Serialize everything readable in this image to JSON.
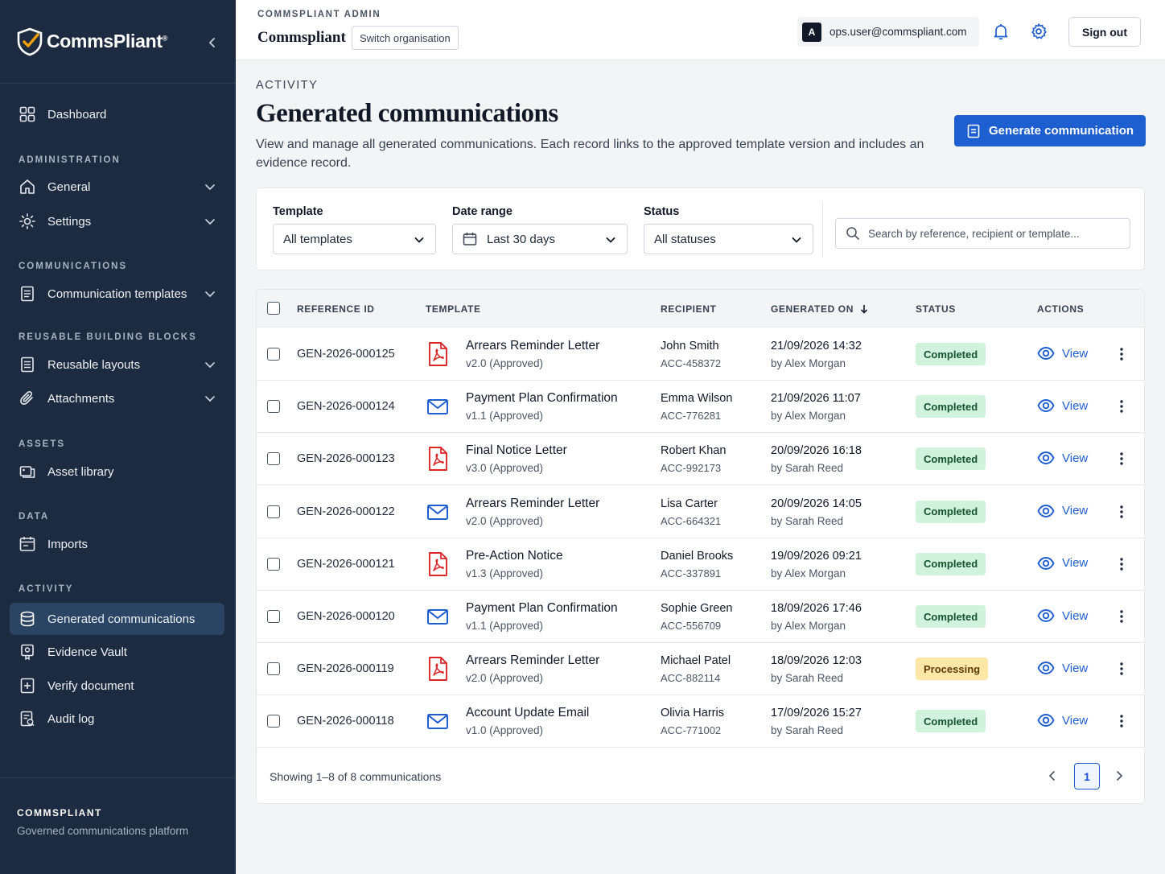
{
  "colors": {
    "sidebar_bg": "#1c2b3f",
    "primary": "#1d5fd1",
    "completed_bg": "#d1f2dc",
    "processing_bg": "#fde7a6",
    "pdf_red": "#dc2626"
  },
  "sidebar": {
    "logo_text": "CommsPliant",
    "logo_reg": "®",
    "dashboard": "Dashboard",
    "sections": {
      "administration": "ADMINISTRATION",
      "communications": "COMMUNICATIONS",
      "reusable": "REUSABLE BUILDING BLOCKS",
      "assets": "ASSETS",
      "data": "DATA",
      "activity": "ACTIVITY"
    },
    "items": {
      "general": "General",
      "settings": "Settings",
      "communication_templates": "Communication templates",
      "reusable_layouts": "Reusable layouts",
      "attachments": "Attachments",
      "asset_library": "Asset library",
      "imports": "Imports",
      "generated_communications": "Generated communications",
      "evidence_vault": "Evidence Vault",
      "verify_document": "Verify document",
      "audit_log": "Audit log"
    },
    "footer_title": "COMMSPLIANT",
    "footer_subtitle": "Governed communications platform"
  },
  "topbar": {
    "kicker": "COMMSPLIANT ADMIN",
    "brand": "Commspliant",
    "switch_org": "Switch organisation",
    "avatar_initial": "A",
    "email": "ops.user@commspliant.com",
    "sign_out": "Sign out"
  },
  "header": {
    "kicker": "ACTIVITY",
    "title": "Generated communications",
    "description": "View and manage all generated communications. Each record links to the approved template version and includes an evidence record.",
    "generate_button": "Generate communication"
  },
  "filters": {
    "template_label": "Template",
    "template_value": "All templates",
    "date_label": "Date range",
    "date_value": "Last 30 days",
    "status_label": "Status",
    "status_value": "All statuses",
    "search_placeholder": "Search by reference, recipient or template..."
  },
  "table": {
    "columns": {
      "reference": "REFERENCE ID",
      "template": "TEMPLATE",
      "recipient": "RECIPIENT",
      "generated_on": "GENERATED ON",
      "status": "STATUS",
      "actions": "ACTIONS"
    },
    "view_label": "View",
    "rows": [
      {
        "ref": "GEN-2026-000125",
        "icon": "pdf-icon",
        "template": "Arrears Reminder Letter",
        "version": "v2.0 (Approved)",
        "recipient": "John Smith",
        "account": "ACC-458372",
        "date": "21/09/2026 14:32",
        "by": "by Alex Morgan",
        "status": "Completed",
        "status_kind": "done"
      },
      {
        "ref": "GEN-2026-000124",
        "icon": "email-icon",
        "template": "Payment Plan Confirmation",
        "version": "v1.1 (Approved)",
        "recipient": "Emma Wilson",
        "account": "ACC-776281",
        "date": "21/09/2026 11:07",
        "by": "by Alex Morgan",
        "status": "Completed",
        "status_kind": "done"
      },
      {
        "ref": "GEN-2026-000123",
        "icon": "pdf-icon",
        "template": "Final Notice Letter",
        "version": "v3.0 (Approved)",
        "recipient": "Robert Khan",
        "account": "ACC-992173",
        "date": "20/09/2026 16:18",
        "by": "by Sarah Reed",
        "status": "Completed",
        "status_kind": "done"
      },
      {
        "ref": "GEN-2026-000122",
        "icon": "email-icon",
        "template": "Arrears Reminder Letter",
        "version": "v2.0 (Approved)",
        "recipient": "Lisa Carter",
        "account": "ACC-664321",
        "date": "20/09/2026 14:05",
        "by": "by Sarah Reed",
        "status": "Completed",
        "status_kind": "done"
      },
      {
        "ref": "GEN-2026-000121",
        "icon": "pdf-icon",
        "template": "Pre-Action Notice",
        "version": "v1.3 (Approved)",
        "recipient": "Daniel Brooks",
        "account": "ACC-337891",
        "date": "19/09/2026 09:21",
        "by": "by Alex Morgan",
        "status": "Completed",
        "status_kind": "done"
      },
      {
        "ref": "GEN-2026-000120",
        "icon": "email-icon",
        "template": "Payment Plan Confirmation",
        "version": "v1.1 (Approved)",
        "recipient": "Sophie Green",
        "account": "ACC-556709",
        "date": "18/09/2026 17:46",
        "by": "by Alex Morgan",
        "status": "Completed",
        "status_kind": "done"
      },
      {
        "ref": "GEN-2026-000119",
        "icon": "pdf-icon",
        "template": "Arrears Reminder Letter",
        "version": "v2.0 (Approved)",
        "recipient": "Michael Patel",
        "account": "ACC-882114",
        "date": "18/09/2026 12:03",
        "by": "by Sarah Reed",
        "status": "Processing",
        "status_kind": "proc"
      },
      {
        "ref": "GEN-2026-000118",
        "icon": "email-icon",
        "template": "Account Update Email",
        "version": "v1.0 (Approved)",
        "recipient": "Olivia Harris",
        "account": "ACC-771002",
        "date": "17/09/2026 15:27",
        "by": "by Sarah Reed",
        "status": "Completed",
        "status_kind": "done"
      }
    ],
    "footer_text": "Showing 1–8 of 8 communications",
    "current_page": "1"
  }
}
